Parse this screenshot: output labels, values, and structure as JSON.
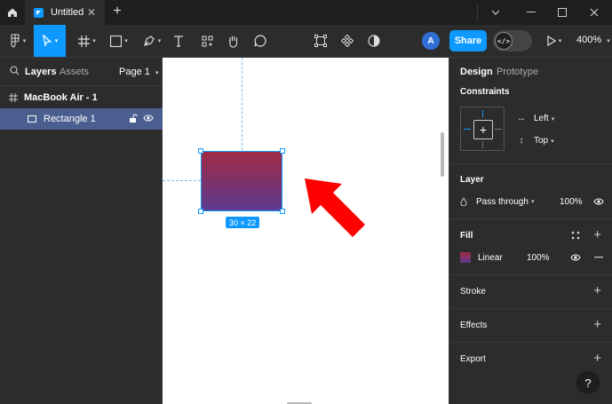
{
  "titlebar": {
    "tab_title": "Untitled",
    "close_glyph": "✕",
    "add_glyph": "+"
  },
  "toolbar": {
    "avatar_initial": "A",
    "share_label": "Share",
    "devmode_glyph": "</>",
    "zoom_label": "400%"
  },
  "left_panel": {
    "tab_layers": "Layers",
    "tab_assets": "Assets",
    "page_label": "Page 1",
    "layers": [
      {
        "label": "MacBook Air - 1"
      },
      {
        "label": "Rectangle 1"
      }
    ]
  },
  "canvas": {
    "size_label": "30 × 22",
    "fill_colors": [
      "#a02a45",
      "#5e3a8f"
    ]
  },
  "right_panel": {
    "tab_design": "Design",
    "tab_prototype": "Prototype",
    "constraints_title": "Constraints",
    "constraint_h": "Left",
    "constraint_v": "Top",
    "layer_title": "Layer",
    "blend_mode": "Pass through",
    "opacity": "100%",
    "fill_title": "Fill",
    "fill_type": "Linear",
    "fill_opacity": "100%",
    "stroke_title": "Stroke",
    "effects_title": "Effects",
    "export_title": "Export",
    "help_glyph": "?"
  },
  "colors": {
    "accent": "#0d99ff",
    "selected_layer": "#4a5f8f",
    "annotation_arrow": "#ff0000"
  }
}
